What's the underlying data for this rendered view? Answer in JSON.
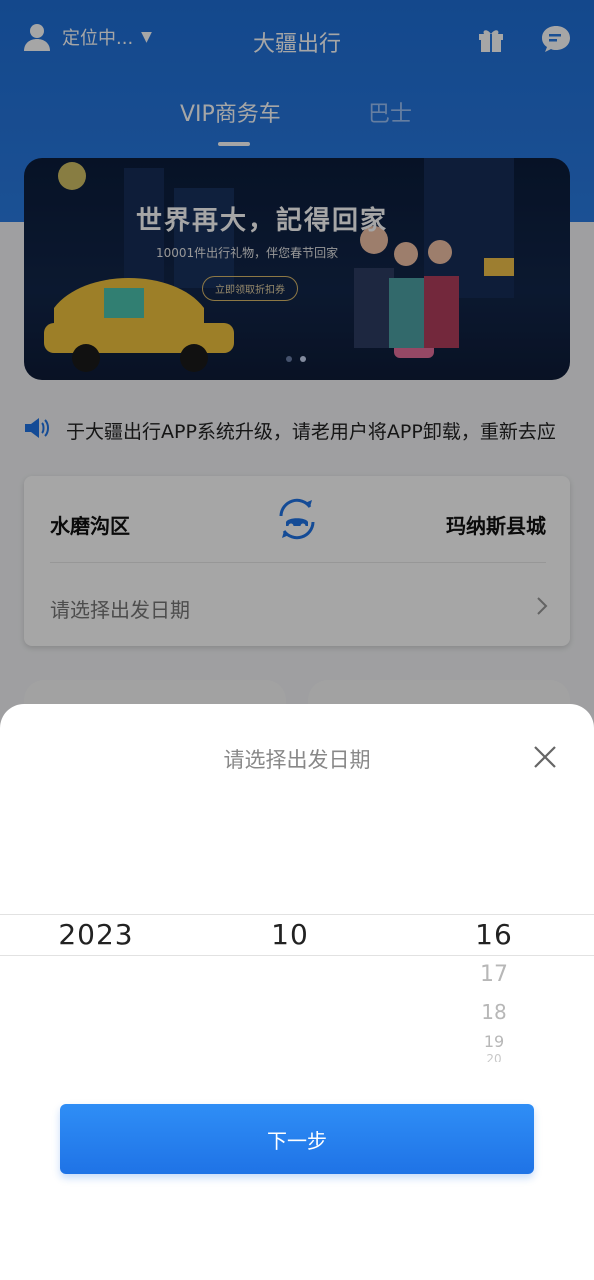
{
  "header": {
    "location_label": "定位中...",
    "app_title": "大疆出行",
    "icons": [
      "user-icon",
      "caret-down-icon",
      "gift-icon",
      "message-icon"
    ]
  },
  "tabs": [
    {
      "label": "VIP商务车",
      "active": true
    },
    {
      "label": "巴士",
      "active": false
    }
  ],
  "banner": {
    "title": "世界再大，記得回家",
    "subtitle": "10001件出行礼物，伴您春节回家",
    "cta": "立即领取折扣券",
    "page_indicator": {
      "count": 2,
      "active_index": 1
    }
  },
  "notice": {
    "icon": "speaker-icon",
    "text": "于大疆出行APP系统升级，请老用户将APP卸载，重新去应"
  },
  "route": {
    "from": "水磨沟区",
    "to": "玛纳斯县城",
    "swap_icon": "swap-car-icon",
    "date_placeholder": "请选择出发日期",
    "chevron_icon": "chevron-right-icon"
  },
  "date_sheet": {
    "title": "请选择出发日期",
    "close_icon": "close-icon",
    "year": "2023",
    "month": "10",
    "day": "16",
    "next_days": [
      "17",
      "18",
      "19",
      "20"
    ],
    "next_button": "下一步"
  },
  "colors": {
    "primary": "#1f73e6",
    "header_blue": "#2a7ce3",
    "overlay": "rgba(0,0,0,0.35)"
  }
}
